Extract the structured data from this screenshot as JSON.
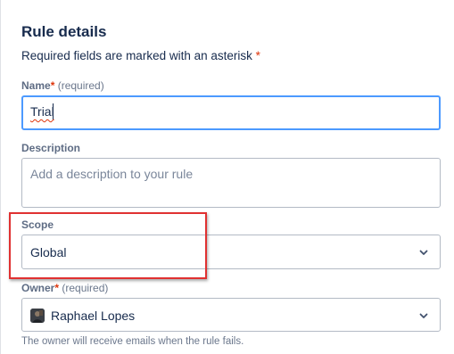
{
  "panel": {
    "title": "Rule details",
    "required_note": "Required fields are marked with an asterisk",
    "required_asterisk": "*"
  },
  "name_field": {
    "label": "Name",
    "asterisk": "*",
    "required_hint": "(required)",
    "value": "Trial"
  },
  "description_field": {
    "label": "Description",
    "placeholder": "Add a description to your rule"
  },
  "scope_field": {
    "label": "Scope",
    "value": "Global",
    "icon": "chevron-down-icon"
  },
  "owner_field": {
    "label": "Owner",
    "asterisk": "*",
    "required_hint": "(required)",
    "value": "Raphael Lopes",
    "helper_text": "The owner will receive emails when the rule fails.",
    "icon": "chevron-down-icon"
  },
  "colors": {
    "focus_border": "#4c9aff",
    "asterisk": "#de350b",
    "highlight": "#e03131"
  }
}
